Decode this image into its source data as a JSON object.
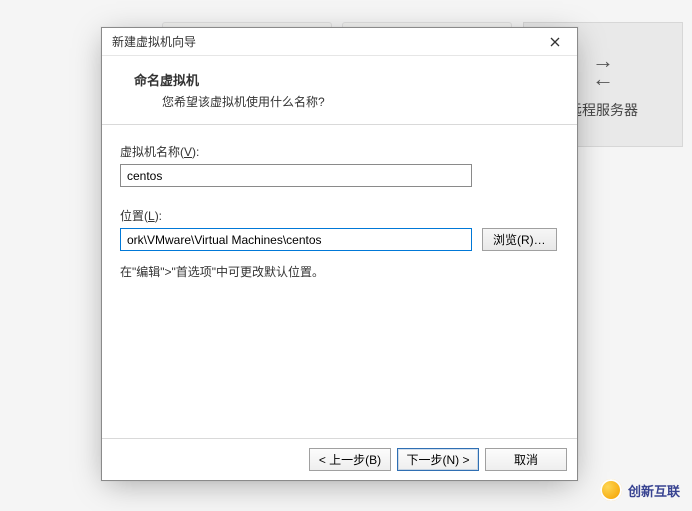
{
  "background": {
    "tile_label": "远程服务器"
  },
  "dialog": {
    "title": "新建虚拟机向导",
    "header": {
      "title": "命名虚拟机",
      "subtitle": "您希望该虚拟机使用什么名称?"
    },
    "fields": {
      "name": {
        "label_pre": "虚拟机名称(",
        "label_mnemonic": "V",
        "label_post": "):",
        "value": "centos"
      },
      "location": {
        "label_pre": "位置(",
        "label_mnemonic": "L",
        "label_post": "):",
        "value": "ork\\VMware\\Virtual Machines\\centos",
        "browse_pre": "浏览(",
        "browse_mnemonic": "R",
        "browse_post": ")…"
      },
      "hint": "在\"编辑\">\"首选项\"中可更改默认位置。"
    },
    "buttons": {
      "back_pre": "< 上一步(",
      "back_mnemonic": "B",
      "back_post": ")",
      "next_pre": "下一步(",
      "next_mnemonic": "N",
      "next_post": ") >",
      "cancel": "取消"
    }
  },
  "watermark": {
    "text": "创新互联"
  }
}
